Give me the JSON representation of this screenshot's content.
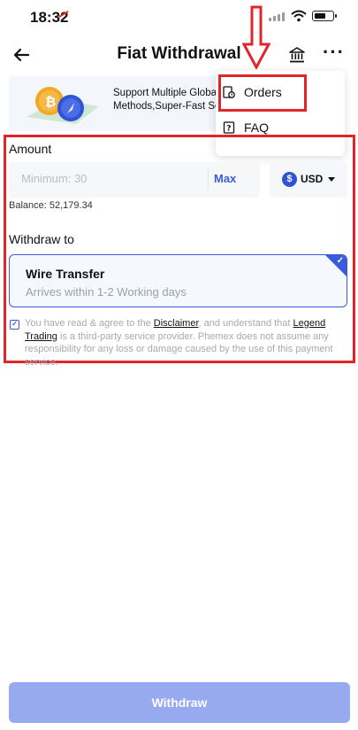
{
  "status_bar": {
    "time": "18:32"
  },
  "header": {
    "title": "Fiat Withdrawal",
    "icons": [
      "back-arrow-icon",
      "bank-icon",
      "more-icon"
    ]
  },
  "banner": {
    "line1": "Support Multiple Globa",
    "line2": "Methods,Super-Fast Se"
  },
  "menu": {
    "items": [
      {
        "label": "Orders",
        "icon": "orders-icon"
      },
      {
        "label": "FAQ",
        "icon": "faq-icon"
      }
    ]
  },
  "form": {
    "amount_label": "Amount",
    "amount_placeholder": "Minimum: 30",
    "max_label": "Max",
    "currency": "USD",
    "balance": "Balance: 52,179.34",
    "withdraw_to_label": "Withdraw to",
    "method": {
      "title": "Wire Transfer",
      "subtitle": "Arrives within 1-2 Working days",
      "selected": true
    },
    "agreement": {
      "checked": true,
      "text1": "You have read & agree to the ",
      "link1": "Disclaimer",
      "text2": ", and understand that ",
      "link2": "Legend Trading",
      "text3": " is a third-party service provider. Phemex does not assume any responsibility for any loss or damage caused by the use of this payment service."
    }
  },
  "footer": {
    "withdraw_label": "Withdraw"
  },
  "colors": {
    "accent": "#3b5bdb",
    "annotation": "#e0262b",
    "button_disabled": "#97aaf0"
  }
}
